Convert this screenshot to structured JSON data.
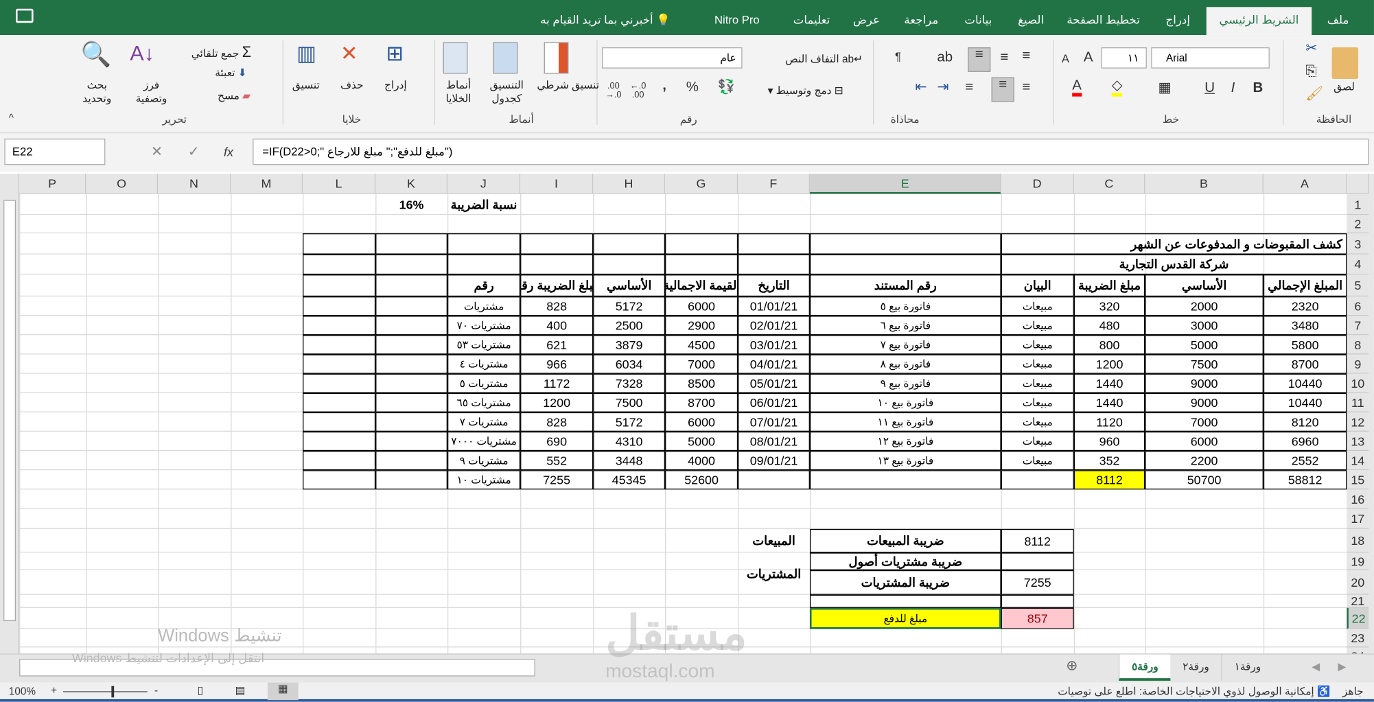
{
  "ribbon_tabs": [
    "ملف",
    "الشريط الرئيسي",
    "إدراج",
    "تخطيط الصفحة",
    "الصيغ",
    "بيانات",
    "مراجعة",
    "عرض",
    "تعليمات",
    "Nitro Pro"
  ],
  "active_tab": "الشريط الرئيسي",
  "tell_me": "أخبرني بما تريد القيام به",
  "ribbon": {
    "clipboard": {
      "label": "الحافظة",
      "paste": "لصق"
    },
    "font": {
      "label": "خط",
      "font_name": "Arial",
      "font_size": "١١",
      "bold": "B",
      "italic": "I",
      "underline": "U"
    },
    "alignment": {
      "label": "محاذاة",
      "wrap_text": "التفاف النص",
      "merge_center": "دمج وتوسيط"
    },
    "number": {
      "label": "رقم",
      "format": "عام",
      "percent": "%",
      "comma": ","
    },
    "styles": {
      "label": "أنماط",
      "conditional": "تنسيق شرطي",
      "format_table": "التنسيق كجدول",
      "cell_styles": "أنماط الخلايا"
    },
    "cells": {
      "label": "خلايا",
      "insert": "إدراج",
      "delete": "حذف",
      "format": "تنسيق"
    },
    "editing": {
      "label": "تحرير",
      "autosum": "جمع تلقائي",
      "fill": "تعبئة",
      "clear": "مسح",
      "sort_filter": "فرز وتصفية",
      "find_select": "بحث وتحديد"
    }
  },
  "formula_bar": {
    "name_box": "E22",
    "fx": "fx",
    "formula": "=IF(D22>0;\" مبلغ للدفع\";\" مبلغ للارجاع\")"
  },
  "sheet": {
    "columns": [
      "A",
      "B",
      "C",
      "D",
      "E",
      "F",
      "G",
      "H",
      "I",
      "J",
      "K",
      "L",
      "M",
      "N",
      "O",
      "P"
    ],
    "rows": [
      "1",
      "2",
      "3",
      "4",
      "5",
      "6",
      "7",
      "8",
      "9",
      "10",
      "11",
      "12",
      "13",
      "14",
      "15",
      "16",
      "17",
      "18",
      "19",
      "20",
      "21",
      "22",
      "23",
      "24"
    ],
    "selected_cell": "E22",
    "cells": {
      "J1": "نسبة الضريبة",
      "K1": "16%",
      "A3": "كشف المقبوضات و المدفوعات عن الشهر",
      "A4": "شركة القدس التجارية",
      "A5": "المبلغ الإجمالي",
      "B5": "الأساسي",
      "C5": "مبلغ الضريبة",
      "D5": "البيان",
      "E5": "رقم المستند",
      "F5": "التاريخ",
      "G5": "القيمة الاجمالية",
      "H5": "الأساسي",
      "I5": "مبلغ الضريبة رقم",
      "J5": "رقم",
      "A6": "2320",
      "B6": "2000",
      "C6": "320",
      "D6": "مبيعات",
      "E6": "فاتورة بيع ٥",
      "F6": "01/01/21",
      "G6": "6000",
      "H6": "5172",
      "I6": "828",
      "J6": "مشتريات",
      "A7": "3480",
      "B7": "3000",
      "C7": "480",
      "D7": "مبيعات",
      "E7": "فاتورة بيع ٦",
      "F7": "02/01/21",
      "G7": "2900",
      "H7": "2500",
      "I7": "400",
      "J7": "مشتريات ٧٠",
      "A8": "5800",
      "B8": "5000",
      "C8": "800",
      "D8": "مبيعات",
      "E8": "فاتورة بيع ٧",
      "F8": "03/01/21",
      "G8": "4500",
      "H8": "3879",
      "I8": "621",
      "J8": "مشتريات ٥٣",
      "A9": "8700",
      "B9": "7500",
      "C9": "1200",
      "D9": "مبيعات",
      "E9": "فاتورة بيع ٨",
      "F9": "04/01/21",
      "G9": "7000",
      "H9": "6034",
      "I9": "966",
      "J9": "مشتريات ٤",
      "A10": "10440",
      "B10": "9000",
      "C10": "1440",
      "D10": "مبيعات",
      "E10": "فاتورة بيع ٩",
      "F10": "05/01/21",
      "G10": "8500",
      "H10": "7328",
      "I10": "1172",
      "J10": "مشتريات ٥",
      "A11": "10440",
      "B11": "9000",
      "C11": "1440",
      "D11": "مبيعات",
      "E11": "فاتورة بيع ١٠",
      "F11": "06/01/21",
      "G11": "8700",
      "H11": "7500",
      "I11": "1200",
      "J11": "مشتريات ٦٥",
      "A12": "8120",
      "B12": "7000",
      "C12": "1120",
      "D12": "مبيعات",
      "E12": "فاتورة بيع ١١",
      "F12": "07/01/21",
      "G12": "6000",
      "H12": "5172",
      "I12": "828",
      "J12": "مشتريات ٧",
      "A13": "6960",
      "B13": "6000",
      "C13": "960",
      "D13": "مبيعات",
      "E13": "فاتورة بيع ١٢",
      "F13": "08/01/21",
      "G13": "5000",
      "H13": "4310",
      "I13": "690",
      "J13": "مشتريات ٧٠٠٠",
      "A14": "2552",
      "B14": "2200",
      "C14": "352",
      "D14": "مبيعات",
      "E14": "فاتورة بيع ١٣",
      "F14": "09/01/21",
      "G14": "4000",
      "H14": "3448",
      "I14": "552",
      "J14": "مشتريات ٩",
      "A15": "58812",
      "B15": "50700",
      "C15": "8112",
      "G15": "52600",
      "H15": "45345",
      "I15": "7255",
      "J15": "مشتريات ١٠",
      "F18": "المبيعات",
      "E18": "ضريبة المبيعات",
      "D18": "8112",
      "E19": "ضريبة مشتريات أصول",
      "F19": "المشتريات",
      "E20": "ضريبة المشتريات",
      "D20": "7255",
      "E22": "مبلغ للدفع",
      "D22": "857"
    },
    "colors": {
      "highlight_yellow": "#ffff00",
      "pink_fill": "#ffc7ce",
      "pink_text": "#9c0006",
      "accent": "#217346"
    }
  },
  "sheet_tabs": [
    {
      "label": "ورقة١"
    },
    {
      "label": "ورقة٢"
    },
    {
      "label": "ورقة٥",
      "active": true
    }
  ],
  "watermark": {
    "activate_title": "تنشيط Windows",
    "activate_sub": "انتقل إلى الإعدادات لتنشيط Windows",
    "logo_ar": "مستقل",
    "logo_en": "mostaql.com"
  },
  "status": {
    "ready": "جاهز",
    "accessibility": "إمكانية الوصول لذوي الاحتياجات الخاصة: اطلع على توصيات",
    "zoom": "100%"
  }
}
